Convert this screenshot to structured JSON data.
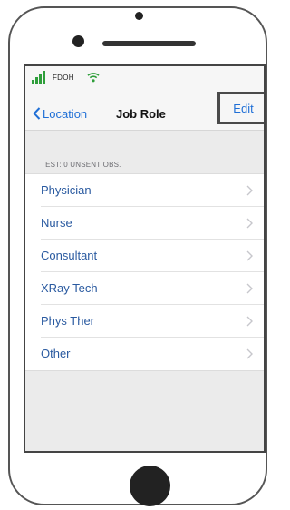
{
  "status_bar": {
    "carrier": "FDOH",
    "signal_icon": "signal-bars-icon",
    "wifi_icon": "wifi-icon",
    "accent_color": "#2e9e3a"
  },
  "nav": {
    "back_label": "Location",
    "title": "Job Role",
    "edit_label": "Edit",
    "link_color": "#1f6fd6"
  },
  "section": {
    "header": "TEST: 0 UNSENT OBS."
  },
  "job_roles": [
    {
      "label": "Physician"
    },
    {
      "label": "Nurse"
    },
    {
      "label": "Consultant"
    },
    {
      "label": "XRay Tech"
    },
    {
      "label": "Phys Ther"
    },
    {
      "label": "Other"
    }
  ]
}
